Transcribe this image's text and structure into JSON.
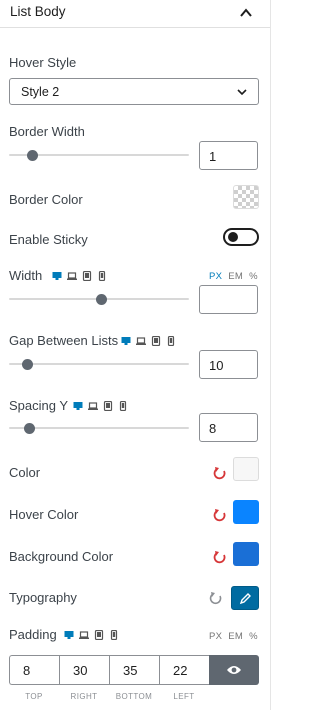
{
  "section": {
    "title": "List Body"
  },
  "hover_style": {
    "label": "Hover Style",
    "value": "Style 2"
  },
  "border_width": {
    "label": "Border Width",
    "value": "1",
    "slider_fraction": 0.13
  },
  "border_color": {
    "label": "Border Color"
  },
  "enable_sticky": {
    "label": "Enable Sticky",
    "enabled": false
  },
  "width": {
    "label": "Width",
    "value": "",
    "slider_fraction": 0.51,
    "units": [
      "PX",
      "EM",
      "%"
    ],
    "active_unit": "PX"
  },
  "gap_between_lists": {
    "label": "Gap Between Lists",
    "value": "10",
    "slider_fraction": 0.1
  },
  "spacing_y": {
    "label": "Spacing Y",
    "value": "8",
    "slider_fraction": 0.11
  },
  "color": {
    "label": "Color",
    "swatch": "#f7f7f7"
  },
  "hover_color": {
    "label": "Hover Color",
    "swatch": "#0a84ff"
  },
  "background_color": {
    "label": "Background Color",
    "swatch": "#1a6fd6"
  },
  "typography": {
    "label": "Typography"
  },
  "padding": {
    "label": "Padding",
    "units": [
      "PX",
      "EM",
      "%"
    ],
    "values": [
      "8",
      "30",
      "35",
      "22"
    ],
    "captions": [
      "TOP",
      "RIGHT",
      "BOTTOM",
      "LEFT"
    ]
  },
  "colors": {
    "accent": "#007cba",
    "reset_red": "#d63638",
    "slider_thumb": "#5f6770"
  },
  "icons": [
    "chevron-up-icon",
    "chevron-down-icon",
    "desktop-icon",
    "laptop-icon",
    "tablet-icon",
    "mobile-icon",
    "reset-icon",
    "pencil-icon",
    "eye-icon"
  ]
}
